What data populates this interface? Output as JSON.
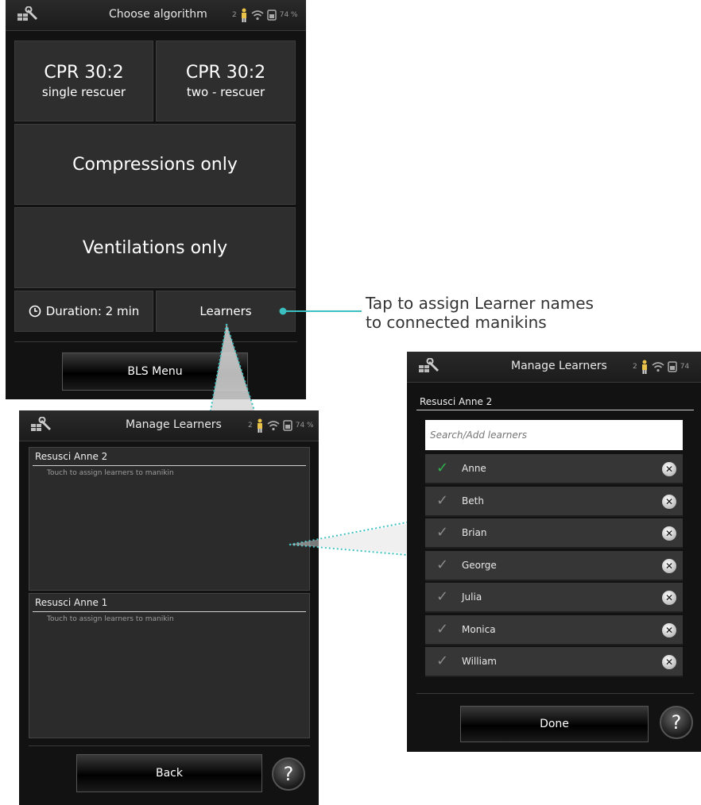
{
  "callout": {
    "line1": "Tap to assign Learner names",
    "line2": "to connected manikins"
  },
  "screen_a": {
    "title": "Choose algorithm",
    "status": {
      "person_count": "2",
      "battery": "74 %"
    },
    "tiles": [
      {
        "line1": "CPR 30:2",
        "line2": "single rescuer"
      },
      {
        "line1": "CPR 30:2",
        "line2": "two - rescuer"
      },
      {
        "label": "Compressions only"
      },
      {
        "label": "Ventilations only"
      }
    ],
    "duration_label": "Duration: 2 min",
    "learners_label": "Learners",
    "bls_menu_label": "BLS Menu"
  },
  "screen_b": {
    "title": "Manage Learners",
    "status": {
      "person_count": "2",
      "battery": "74 %"
    },
    "panels": [
      {
        "title": "Resusci Anne 2",
        "hint": "Touch to assign learners to manikin"
      },
      {
        "title": "Resusci Anne 1",
        "hint": "Touch to assign learners to manikin"
      }
    ],
    "back_label": "Back",
    "help_label": "?"
  },
  "screen_c": {
    "title": "Manage Learners",
    "status": {
      "person_count": "2",
      "battery": "74"
    },
    "manikin": "Resusci Anne 2",
    "search_placeholder": "Search/Add learners",
    "learners": [
      {
        "name": "Anne",
        "selected": true
      },
      {
        "name": "Beth",
        "selected": false
      },
      {
        "name": "Brian",
        "selected": false
      },
      {
        "name": "George",
        "selected": false
      },
      {
        "name": "Julia",
        "selected": false
      },
      {
        "name": "Monica",
        "selected": false
      },
      {
        "name": "William",
        "selected": false
      }
    ],
    "done_label": "Done",
    "help_label": "?"
  },
  "colors": {
    "accent": "#3bbfbf",
    "check_active": "#2fb24a",
    "check_inactive": "#8a8a8a"
  }
}
